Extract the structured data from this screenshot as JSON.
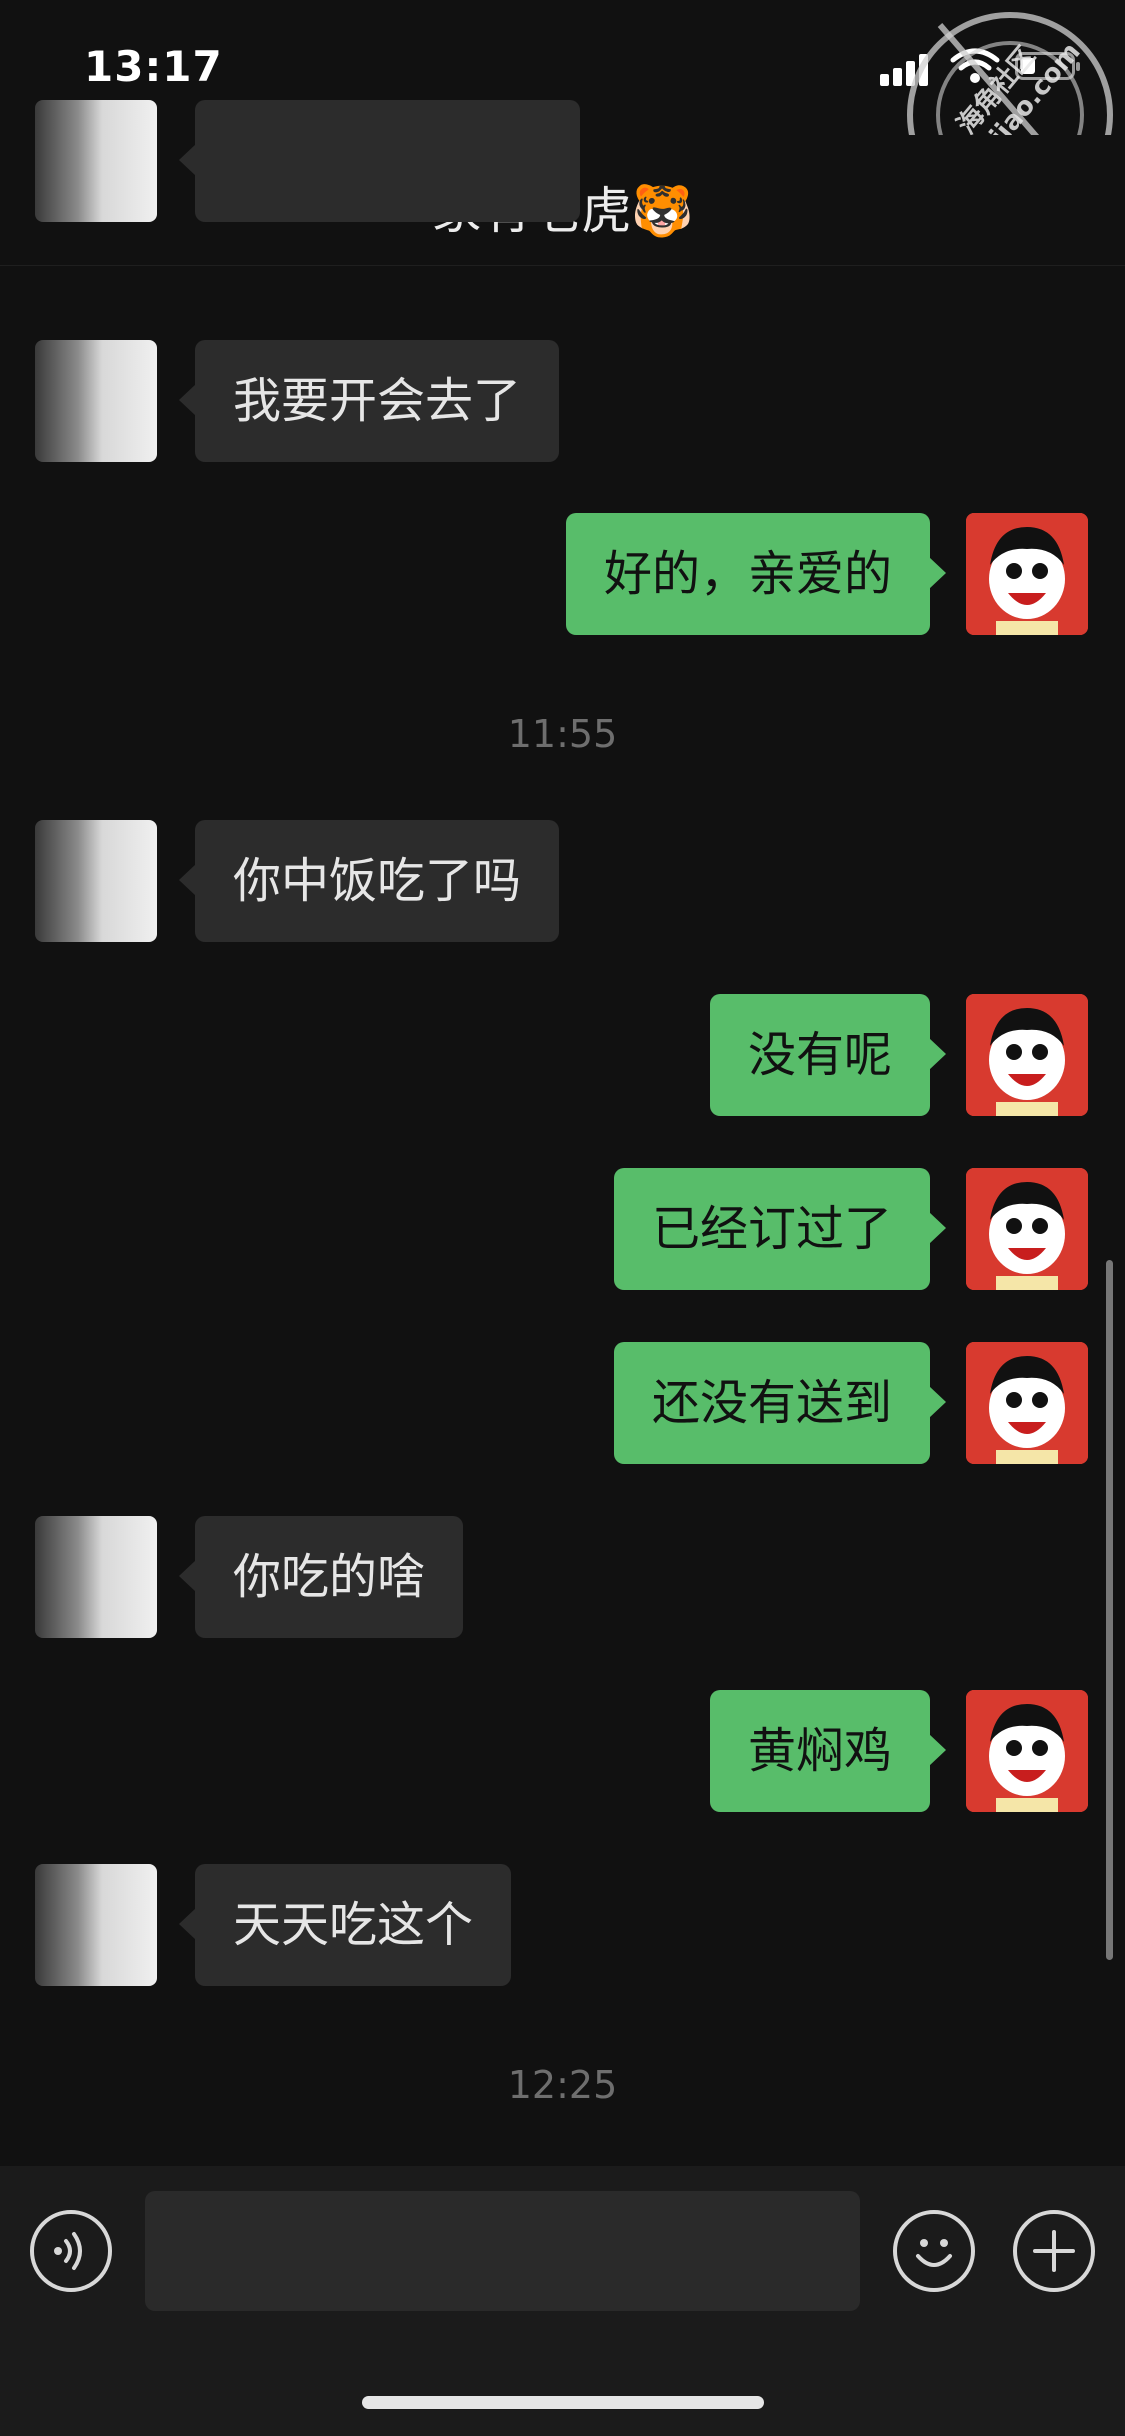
{
  "status_bar": {
    "time": "13:17"
  },
  "watermark": {
    "line1": "海角社区",
    "line2": "haijiao.com"
  },
  "nav": {
    "title": "家有老虎",
    "title_emoji": "🐯"
  },
  "messages": [
    {
      "sender": "friend",
      "text": "我要开会去了"
    },
    {
      "sender": "me",
      "text": "好的，亲爱的"
    },
    {
      "type": "time",
      "text": "11:55"
    },
    {
      "sender": "friend",
      "text": "你中饭吃了吗"
    },
    {
      "sender": "me",
      "text": "没有呢"
    },
    {
      "sender": "me",
      "text": "已经订过了"
    },
    {
      "sender": "me",
      "text": "还没有送到"
    },
    {
      "sender": "friend",
      "text": "你吃的啥"
    },
    {
      "sender": "me",
      "text": "黄焖鸡"
    },
    {
      "sender": "friend",
      "text": "天天吃这个"
    },
    {
      "type": "time",
      "text": "12:25"
    }
  ],
  "input": {
    "value": "",
    "placeholder": ""
  },
  "colors": {
    "background": "#111111",
    "my_bubble": "#58bd6a",
    "friend_bubble": "#2c2c2c"
  }
}
